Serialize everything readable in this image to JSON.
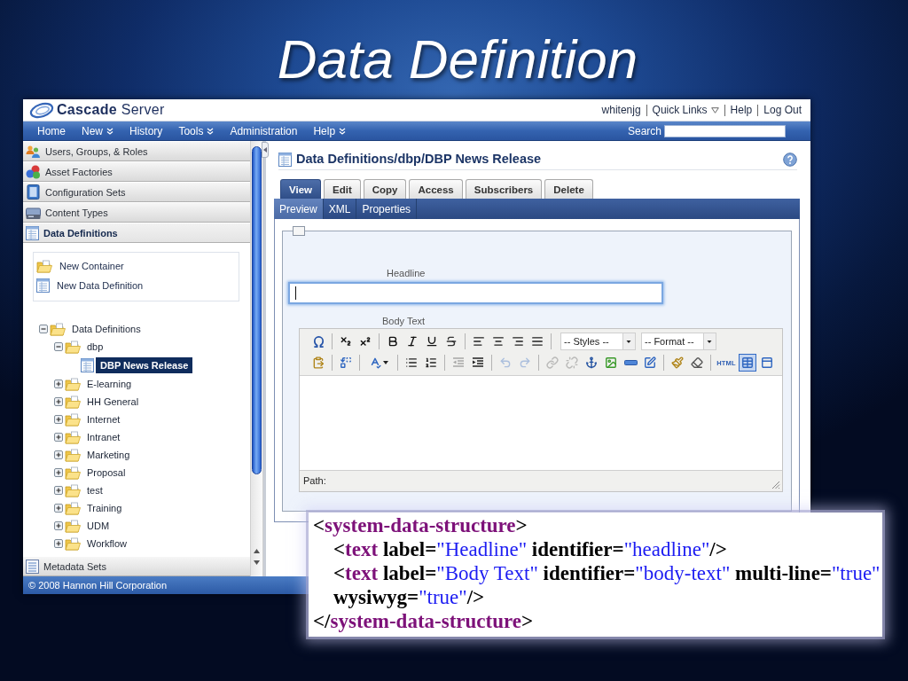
{
  "slide": {
    "title": "Data Definition"
  },
  "header": {
    "logo": "**Cascade** Server",
    "links": [
      {
        "label": "whitenjg",
        "kind": "user"
      },
      {
        "label": "Quick Links",
        "kind": "menu"
      },
      {
        "label": "Help",
        "kind": "link"
      },
      {
        "label": "Log Out",
        "kind": "link"
      }
    ]
  },
  "nav": {
    "items": [
      {
        "label": "Home",
        "has_menu": false
      },
      {
        "label": "New",
        "has_menu": true
      },
      {
        "label": "History",
        "has_menu": false
      },
      {
        "label": "Tools",
        "has_menu": true
      },
      {
        "label": "Administration",
        "has_menu": false
      },
      {
        "label": "Help",
        "has_menu": true
      }
    ],
    "search": {
      "label": "Search"
    }
  },
  "sidebar": {
    "sections": [
      {
        "label": "Users, Groups, & Roles",
        "kind": "users",
        "expanded": false
      },
      {
        "label": "Asset Factories",
        "kind": "factories",
        "expanded": false
      },
      {
        "label": "Configuration Sets",
        "kind": "configuration",
        "expanded": false
      },
      {
        "label": "Content Types",
        "kind": "contenttypes",
        "expanded": false
      },
      {
        "label": "Data Definitions",
        "kind": "definitions",
        "expanded": true
      },
      {
        "label": "Metadata Sets",
        "kind": "metadata",
        "expanded": false
      }
    ],
    "actions": [
      {
        "label": "New Container",
        "kind": "folder"
      },
      {
        "label": "New Data Definition",
        "kind": "definition"
      }
    ],
    "tree": [
      {
        "label": "Data Definitions",
        "kind": "folder",
        "expanded": true,
        "selected": false,
        "children": [
          {
            "label": "dbp",
            "kind": "folder",
            "expanded": true,
            "selected": false,
            "children": [
              {
                "label": "DBP News Release",
                "kind": "definition",
                "selected": true
              }
            ]
          },
          {
            "label": "E-learning",
            "kind": "folder",
            "expanded": false,
            "selected": false
          },
          {
            "label": "HH General",
            "kind": "folder",
            "expanded": false,
            "selected": false
          },
          {
            "label": "Internet",
            "kind": "folder",
            "expanded": false,
            "selected": false
          },
          {
            "label": "Intranet",
            "kind": "folder",
            "expanded": false,
            "selected": false
          },
          {
            "label": "Marketing",
            "kind": "folder",
            "expanded": false,
            "selected": false
          },
          {
            "label": "Proposal",
            "kind": "folder",
            "expanded": false,
            "selected": false
          },
          {
            "label": "test",
            "kind": "folder",
            "expanded": false,
            "selected": false
          },
          {
            "label": "Training",
            "kind": "folder",
            "expanded": false,
            "selected": false
          },
          {
            "label": "UDM",
            "kind": "folder",
            "expanded": false,
            "selected": false
          },
          {
            "label": "Workflow",
            "kind": "folder",
            "expanded": false,
            "selected": false
          }
        ]
      }
    ]
  },
  "main": {
    "title": "Data Definitions/dbp/DBP News Release",
    "tabs": [
      {
        "label": "View",
        "selected": true
      },
      {
        "label": "Edit",
        "selected": false
      },
      {
        "label": "Copy",
        "selected": false
      },
      {
        "label": "Access",
        "selected": false
      },
      {
        "label": "Subscribers",
        "selected": false
      },
      {
        "label": "Delete",
        "selected": false
      }
    ],
    "subtabs": [
      {
        "label": "Preview",
        "selected": true
      },
      {
        "label": "XML",
        "selected": false
      },
      {
        "label": "Properties",
        "selected": false
      }
    ],
    "fields": [
      {
        "kind": "text",
        "label": "Headline",
        "focused": true
      },
      {
        "kind": "wysiwyg",
        "label": "Body Text",
        "path_label": "Path:",
        "toolbar_rows": [
          {
            "groups": [
              [
                {
                  "kind": "omega",
                  "disabled": false,
                  "active": false
                }
              ],
              [
                {
                  "kind": "subscript",
                  "disabled": false,
                  "active": false
                },
                {
                  "kind": "superscript",
                  "disabled": false,
                  "active": false
                }
              ],
              [
                {
                  "kind": "bold",
                  "disabled": false,
                  "active": false
                },
                {
                  "kind": "italic",
                  "disabled": false,
                  "active": false
                },
                {
                  "kind": "underline",
                  "disabled": false,
                  "active": false
                },
                {
                  "kind": "strikethrough",
                  "disabled": false,
                  "active": false
                }
              ],
              [
                {
                  "kind": "alignleft",
                  "disabled": false,
                  "active": false
                },
                {
                  "kind": "aligncenter",
                  "disabled": false,
                  "active": false
                },
                {
                  "kind": "alignright",
                  "disabled": false,
                  "active": false
                },
                {
                  "kind": "justify",
                  "disabled": false,
                  "active": false
                }
              ],
              [
                {
                  "kind": "select",
                  "value": "-- Styles --"
                },
                {
                  "kind": "select",
                  "value": "-- Format --"
                }
              ]
            ]
          },
          {
            "groups": [
              [
                {
                  "kind": "pasteword",
                  "disabled": false,
                  "active": false
                }
              ],
              [
                {
                  "kind": "replace",
                  "disabled": false,
                  "active": false
                }
              ],
              [
                {
                  "kind": "spellcheck",
                  "disabled": false,
                  "active": false
                }
              ],
              [
                {
                  "kind": "bullets",
                  "disabled": false,
                  "active": false
                },
                {
                  "kind": "numbers",
                  "disabled": false,
                  "active": false
                }
              ],
              [
                {
                  "kind": "outdent",
                  "disabled": true,
                  "active": false
                },
                {
                  "kind": "indent",
                  "disabled": false,
                  "active": false
                }
              ],
              [
                {
                  "kind": "undo",
                  "disabled": true,
                  "active": false
                },
                {
                  "kind": "redo",
                  "disabled": true,
                  "active": false
                }
              ],
              [
                {
                  "kind": "link",
                  "disabled": true,
                  "active": false
                },
                {
                  "kind": "unlink",
                  "disabled": true,
                  "active": false
                },
                {
                  "kind": "anchor",
                  "disabled": false,
                  "active": false
                },
                {
                  "kind": "image",
                  "disabled": false,
                  "active": false
                },
                {
                  "kind": "rule",
                  "disabled": false,
                  "active": false
                },
                {
                  "kind": "edit",
                  "disabled": false,
                  "active": false
                }
              ],
              [
                {
                  "kind": "cleanup",
                  "disabled": false,
                  "active": false
                },
                {
                  "kind": "eraser",
                  "disabled": false,
                  "active": false
                }
              ],
              [
                {
                  "kind": "html",
                  "label": "HTML",
                  "disabled": false,
                  "active": false
                },
                {
                  "kind": "table",
                  "disabled": false,
                  "active": true
                },
                {
                  "kind": "visualaid",
                  "disabled": false,
                  "active": false
                }
              ]
            ]
          }
        ]
      }
    ]
  },
  "footer": {
    "text": "© 2008 Hannon Hill Corporation"
  },
  "xml_overlay": {
    "lines": [
      {
        "tokens": [
          {
            "kind": "bracket",
            "text": "<"
          },
          {
            "kind": "tag",
            "text": "system-data-structure"
          },
          {
            "kind": "bracket",
            "text": ">"
          }
        ],
        "children": [
          {
            "tokens": [
              {
                "kind": "bracket",
                "text": "<"
              },
              {
                "kind": "tag",
                "text": "text"
              },
              {
                "kind": "attr",
                "text": " label="
              },
              {
                "kind": "value",
                "text": "\"Headline\""
              },
              {
                "kind": "attr",
                "text": " identifier="
              },
              {
                "kind": "value",
                "text": "\"headline\""
              },
              {
                "kind": "bracket",
                "text": "/>"
              }
            ]
          },
          {
            "tokens": [
              {
                "kind": "bracket",
                "text": "<"
              },
              {
                "kind": "tag",
                "text": "text"
              },
              {
                "kind": "attr",
                "text": " label="
              },
              {
                "kind": "value",
                "text": "\"Body Text\""
              },
              {
                "kind": "attr",
                "text": " identifier="
              },
              {
                "kind": "value",
                "text": "\"body-text\""
              },
              {
                "kind": "attr",
                "text": " multi-line="
              },
              {
                "kind": "value",
                "text": "\"true\""
              }
            ]
          },
          {
            "tokens": [
              {
                "kind": "attr",
                "text": "wysiwyg="
              },
              {
                "kind": "value",
                "text": "\"true\""
              },
              {
                "kind": "bracket",
                "text": "/>"
              }
            ]
          }
        ]
      },
      {
        "tokens": [
          {
            "kind": "bracket",
            "text": "</"
          },
          {
            "kind": "tag",
            "text": "system-data-structure"
          },
          {
            "kind": "bracket",
            "text": ">"
          }
        ]
      }
    ]
  }
}
